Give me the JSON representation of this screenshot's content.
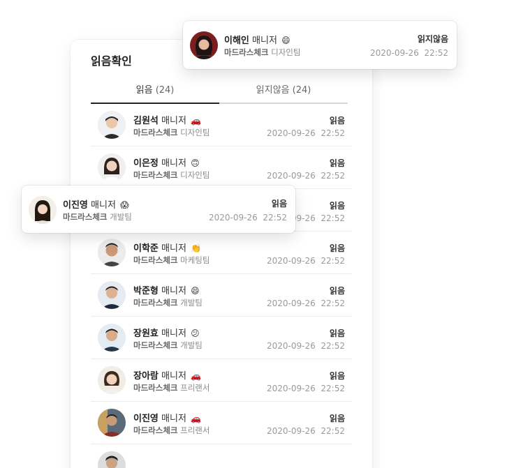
{
  "panel": {
    "title": "읽음확인",
    "tabs": [
      {
        "label": "읽음",
        "count": "(24)"
      },
      {
        "label": "읽지않음",
        "count": "(24)"
      }
    ]
  },
  "list": [
    {
      "name": "김원석",
      "role": "매니저",
      "emoji": "🚗",
      "company": "마드라스체크",
      "team": "디자인팀",
      "status": "읽음",
      "date": "2020-09-26",
      "time": "22:52",
      "avatar": "avatar-man-1"
    },
    {
      "name": "이은정",
      "role": "매니저",
      "emoji": "🙃",
      "company": "마드라스체크",
      "team": "디자인팀",
      "status": "읽음",
      "date": "2020-09-26",
      "time": "22:52",
      "avatar": "avatar-woman-1"
    },
    {
      "name": "",
      "role": "",
      "emoji": "",
      "company": "",
      "team": "",
      "status": "읽음",
      "date": "2020-09-26",
      "time": "22:52",
      "avatar": "hidden"
    },
    {
      "name": "이학준",
      "role": "매니저",
      "emoji": "👏",
      "company": "마드라스체크",
      "team": "마케팅팀",
      "status": "읽음",
      "date": "2020-09-26",
      "time": "22:52",
      "avatar": "avatar-man-2"
    },
    {
      "name": "박준형",
      "role": "매니저",
      "emoji": "😄",
      "company": "마드라스체크",
      "team": "개발팀",
      "status": "읽음",
      "date": "2020-09-26",
      "time": "22:52",
      "avatar": "avatar-man-3"
    },
    {
      "name": "장원효",
      "role": "매니저",
      "emoji": "😕",
      "company": "마드라스체크",
      "team": "개발팀",
      "status": "읽음",
      "date": "2020-09-26",
      "time": "22:52",
      "avatar": "avatar-man-4"
    },
    {
      "name": "장아람",
      "role": "매니저",
      "emoji": "🚗",
      "company": "마드라스체크",
      "team": "프리랜서",
      "status": "읽음",
      "date": "2020-09-26",
      "time": "22:52",
      "avatar": "avatar-woman-2"
    },
    {
      "name": "이진영",
      "role": "매니저",
      "emoji": "🚗",
      "company": "마드라스체크",
      "team": "프리랜서",
      "status": "읽음",
      "date": "2020-09-26",
      "time": "22:52",
      "avatar": "avatar-man-5"
    }
  ],
  "card_top": {
    "name": "이해인",
    "role": "매니저",
    "emoji": "😄",
    "company": "마드라스체크",
    "team": "디자인팀",
    "status": "읽지않음",
    "date": "2020-09-26",
    "time": "22:52"
  },
  "card_mid": {
    "name": "이진영",
    "role": "매니저",
    "emoji": "😱",
    "company": "마드라스체크",
    "team": "개발팀",
    "status": "읽음",
    "date": "2020-09-26",
    "time": "22:52"
  },
  "colors": {
    "accent": "#222222",
    "muted": "#9a9a9a",
    "tab_inactive": "#d6d6d6"
  }
}
